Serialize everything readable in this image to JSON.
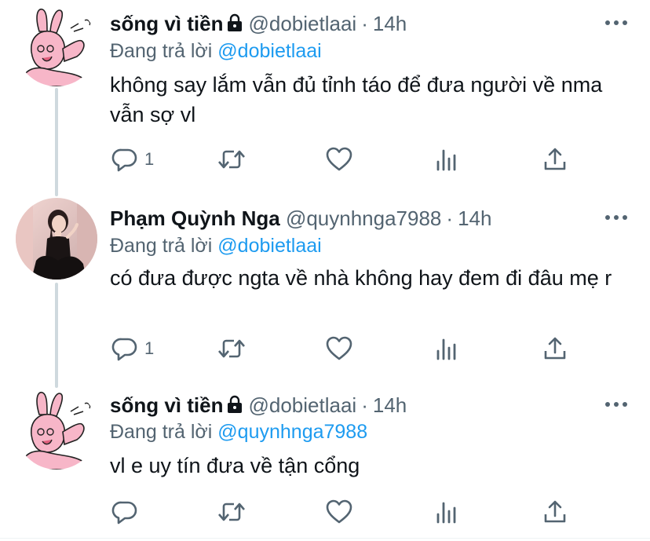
{
  "tweets": [
    {
      "display_name": "sống vì tiền",
      "handle": "@dobietlaai",
      "separator": "·",
      "time": "14h",
      "reply_prefix": "Đang trả lời",
      "reply_handle": "@dobietlaai",
      "text": "không say lắm vẫn đủ tỉnh táo để đưa người về nma vẫn sợ vl",
      "reply_count": "1",
      "avatar": "pink-bunny-avatar"
    },
    {
      "display_name": "Phạm Quỳnh Nga",
      "handle": "@quynhnga7988",
      "separator": "·",
      "time": "14h",
      "reply_prefix": "Đang trả lời",
      "reply_handle": "@dobietlaai",
      "text": "có đưa được ngta về nhà không hay đem đi đâu mẹ r",
      "reply_count": "1",
      "avatar": "woman-photo-avatar"
    },
    {
      "display_name": "sống vì tiền",
      "handle": "@dobietlaai",
      "separator": "·",
      "time": "14h",
      "reply_prefix": "Đang trả lời",
      "reply_handle": "@quynhnga7988",
      "text": "vl e uy tín đưa về tận cổng",
      "reply_count": "",
      "avatar": "pink-bunny-avatar"
    }
  ],
  "colors": {
    "text": "#0f1419",
    "secondary": "#536471",
    "link": "#1d9bf0",
    "thread_line": "#cfd9de",
    "bunny": "#f7b6c8"
  },
  "icons": [
    "lock-icon",
    "more-icon",
    "reply-icon",
    "retweet-icon",
    "like-icon",
    "views-icon",
    "share-icon"
  ]
}
